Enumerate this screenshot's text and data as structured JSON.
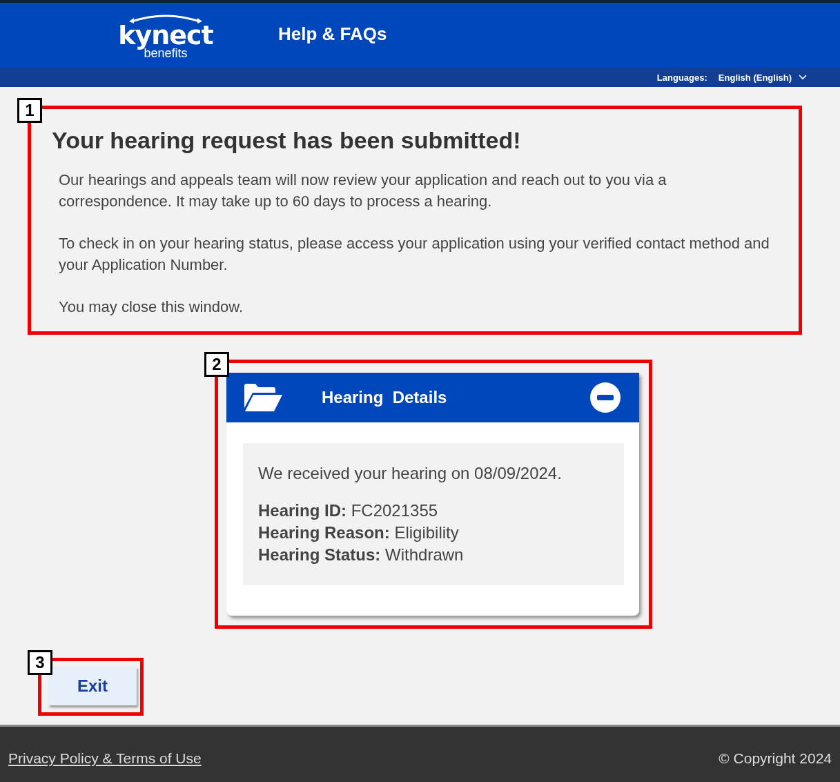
{
  "header": {
    "logo": {
      "wordmark": "kynect",
      "subtitle": "benefits"
    },
    "title": "Help & FAQs",
    "languages_label": "Languages:",
    "language": "English (English)"
  },
  "confirmation": {
    "callout": "1",
    "heading": "Your hearing request has been submitted!",
    "paragraphs": [
      "Our hearings and appeals team will now review your application and reach out to you via a correspondence. It may take up to 60 days to process a hearing.",
      "To check in on your hearing status, please access your application using your verified contact method and your Application Number.",
      "You may close this window."
    ]
  },
  "details_card": {
    "callout": "2",
    "title": "Hearing  Details",
    "expanded": true,
    "intro": "We received your hearing on 08/09/2024.",
    "fields": [
      "**Hearing ID:** FC2021355",
      "**Hearing Reason:** Eligibility",
      "**Hearing Status:** Withdrawn"
    ]
  },
  "exit_button": {
    "callout": "3",
    "label": "Exit"
  },
  "footer": {
    "link": "Privacy Policy & Terms of Use",
    "copyright": "© Copyright 2024"
  }
}
